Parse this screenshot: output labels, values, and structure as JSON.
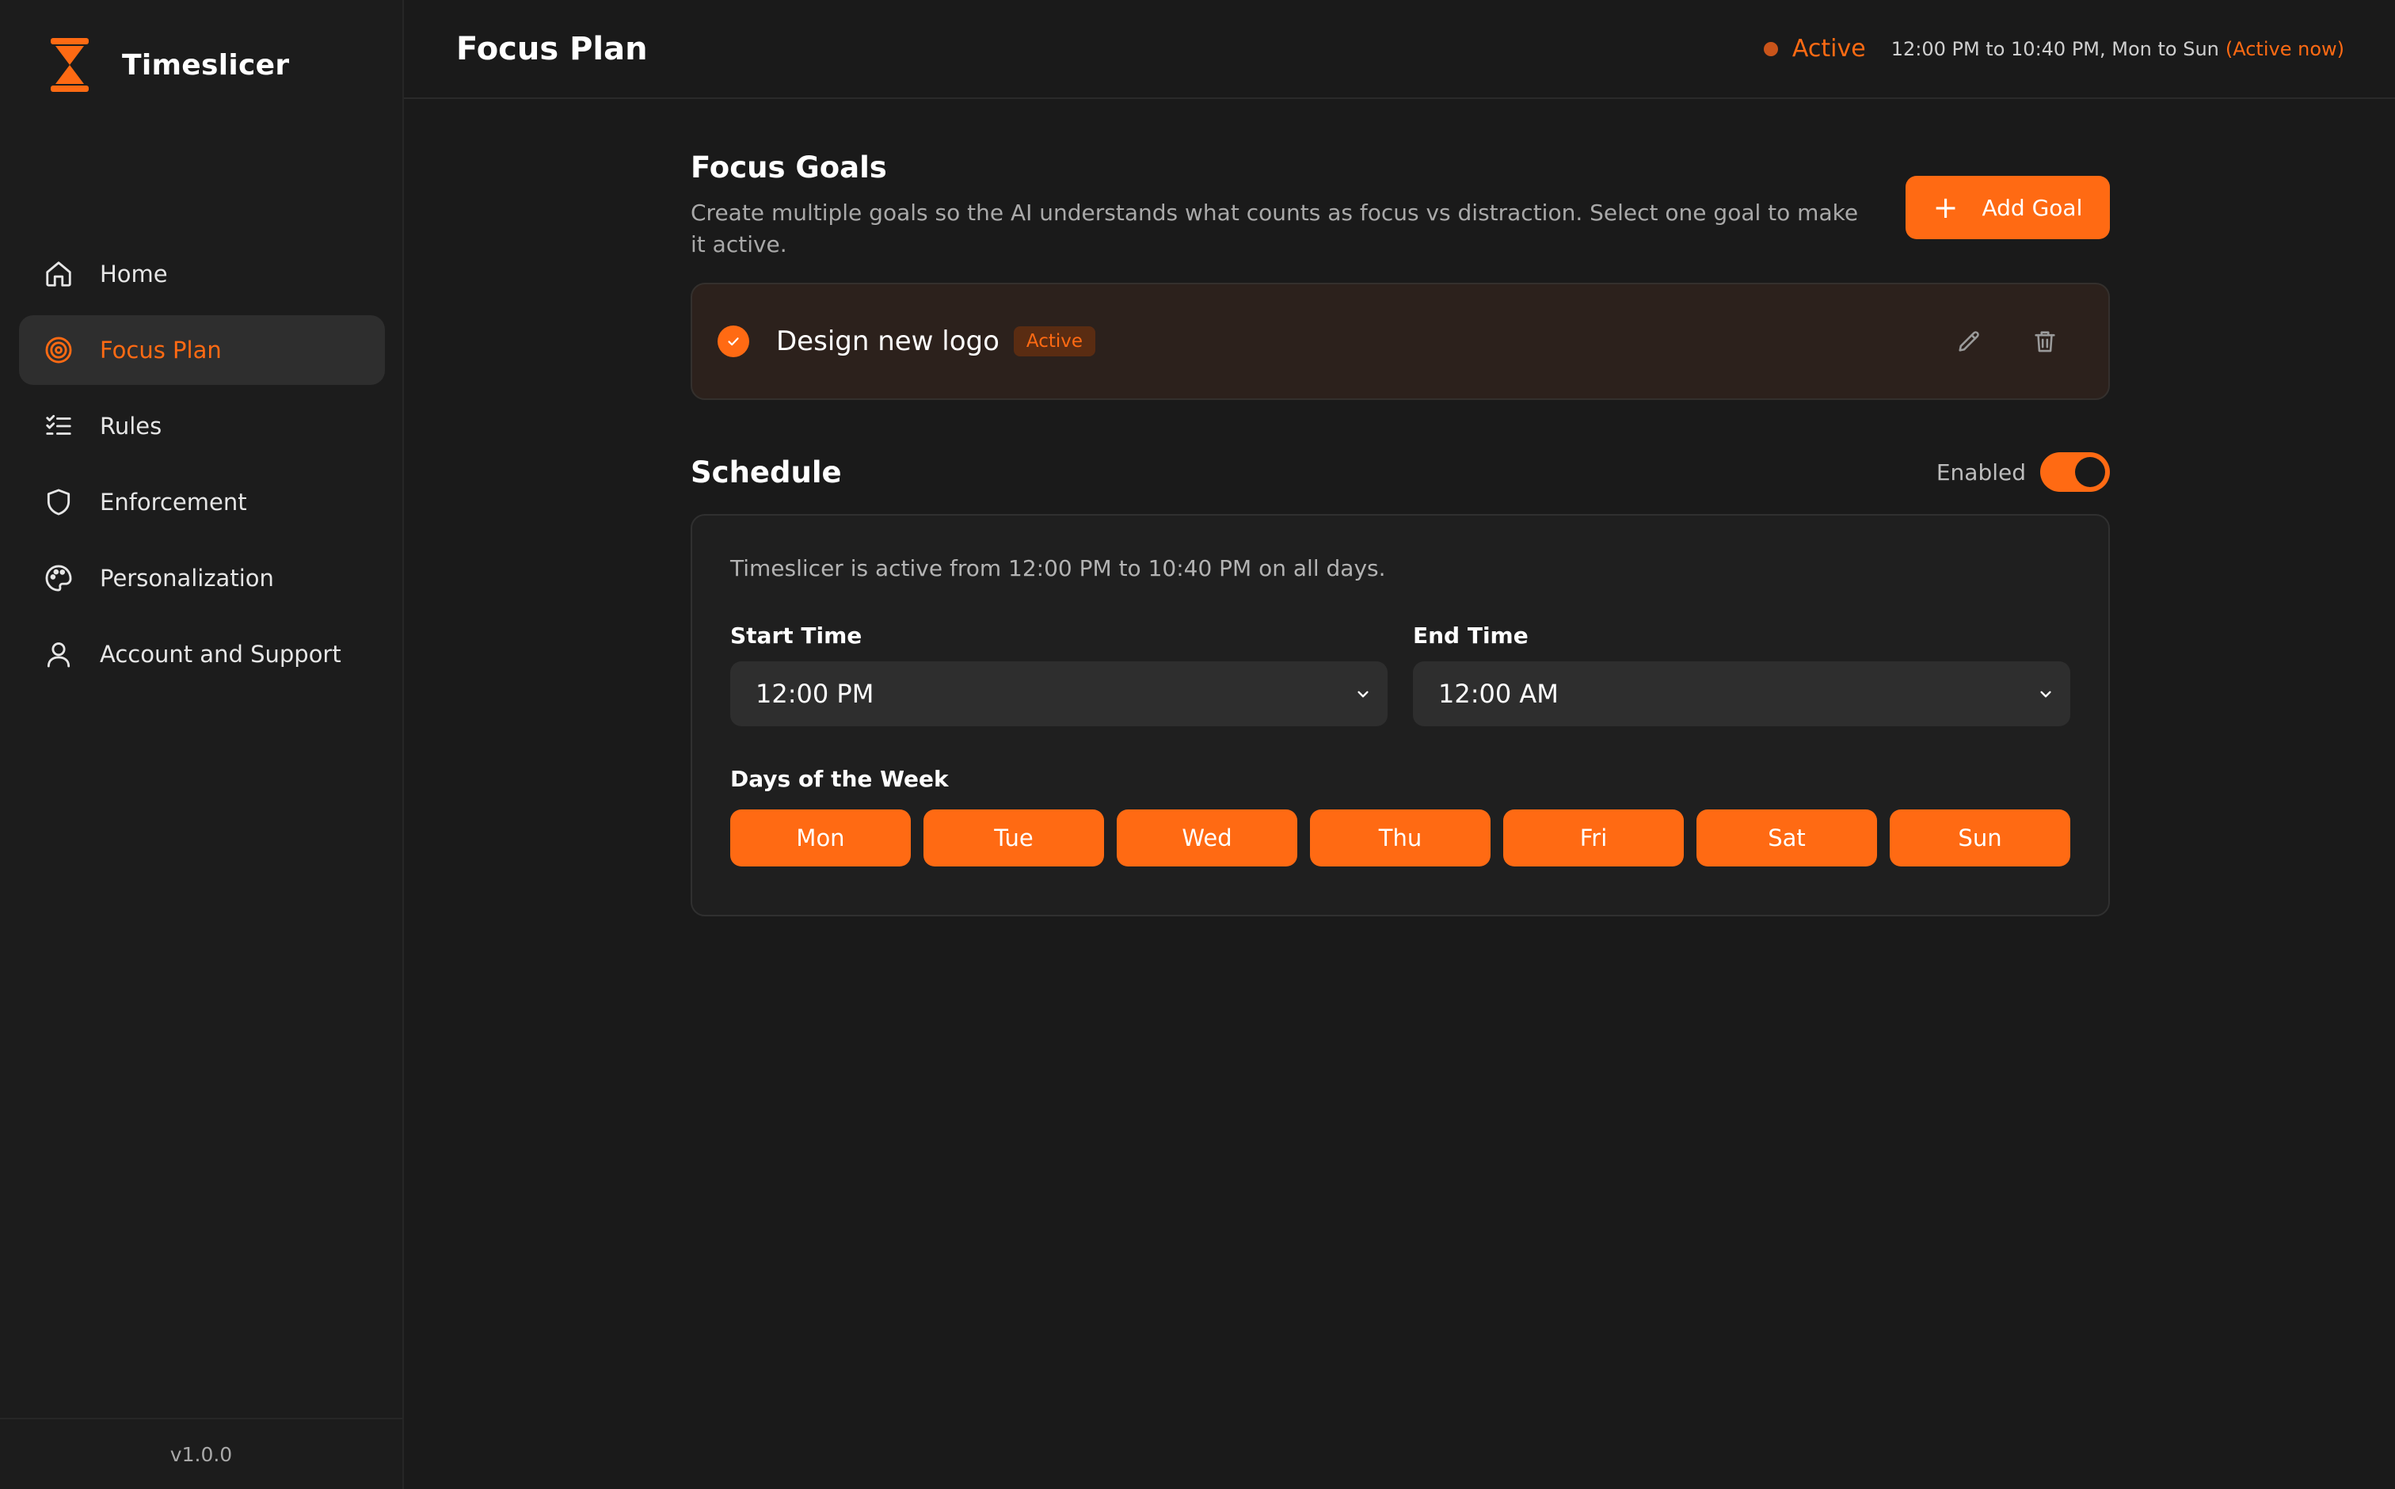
{
  "app": {
    "name": "Timeslicer",
    "version": "v1.0.0",
    "accent": "#ff6a13"
  },
  "sidebar": {
    "items": [
      {
        "label": "Home",
        "icon": "home-icon",
        "active": false
      },
      {
        "label": "Focus Plan",
        "icon": "target-icon",
        "active": true
      },
      {
        "label": "Rules",
        "icon": "checklist-icon",
        "active": false
      },
      {
        "label": "Enforcement",
        "icon": "shield-icon",
        "active": false
      },
      {
        "label": "Personalization",
        "icon": "palette-icon",
        "active": false
      },
      {
        "label": "Account and Support",
        "icon": "user-icon",
        "active": false
      }
    ]
  },
  "header": {
    "title": "Focus Plan",
    "status_label": "Active",
    "status_range": "12:00 PM to 10:40 PM, Mon to Sun",
    "status_now": "(Active now)"
  },
  "goals": {
    "title": "Focus Goals",
    "description": "Create multiple goals so the AI understands what counts as focus vs distraction. Select one goal to make it active.",
    "add_label": "Add Goal",
    "items": [
      {
        "name": "Design new logo",
        "badge": "Active"
      }
    ]
  },
  "schedule": {
    "title": "Schedule",
    "enabled_label": "Enabled",
    "enabled": true,
    "info": "Timeslicer is active from 12:00 PM to 10:40 PM on all days.",
    "start_label": "Start Time",
    "start_value": "12:00 PM",
    "end_label": "End Time",
    "end_value": "12:00 AM",
    "days_label": "Days of the Week",
    "days": [
      "Mon",
      "Tue",
      "Wed",
      "Thu",
      "Fri",
      "Sat",
      "Sun"
    ]
  }
}
